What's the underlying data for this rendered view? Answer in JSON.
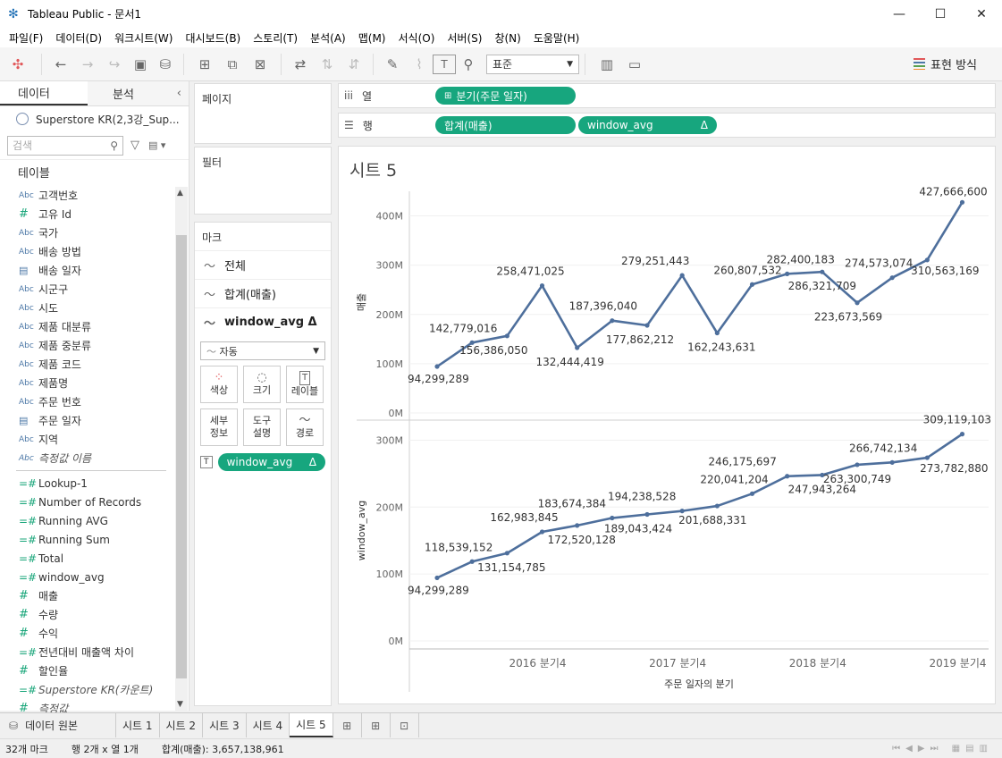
{
  "window": {
    "title": "Tableau Public - 문서1"
  },
  "menu": [
    "파일(F)",
    "데이터(D)",
    "워크시트(W)",
    "대시보드(B)",
    "스토리(T)",
    "분석(A)",
    "맵(M)",
    "서식(O)",
    "서버(S)",
    "창(N)",
    "도움말(H)"
  ],
  "toolbar": {
    "fit_value": "표준",
    "show_me": "표현 방식"
  },
  "left": {
    "tab_data": "데이터",
    "tab_analysis": "분석",
    "datasource": "Superstore KR(2,3강_Sup...",
    "search_placeholder": "검색",
    "tables_header": "테이블",
    "fields": [
      {
        "type": "Abc",
        "name": "고객번호"
      },
      {
        "type": "#",
        "name": "고유 Id"
      },
      {
        "type": "Abc",
        "name": "국가"
      },
      {
        "type": "Abc",
        "name": "배송 방법"
      },
      {
        "type": "cal",
        "name": "배송 일자"
      },
      {
        "type": "Abc",
        "name": "시군구"
      },
      {
        "type": "Abc",
        "name": "시도"
      },
      {
        "type": "Abc",
        "name": "제품 대분류"
      },
      {
        "type": "Abc",
        "name": "제품 중분류"
      },
      {
        "type": "Abc",
        "name": "제품 코드"
      },
      {
        "type": "Abc",
        "name": "제품명"
      },
      {
        "type": "Abc",
        "name": "주문 번호"
      },
      {
        "type": "cal",
        "name": "주문 일자"
      },
      {
        "type": "Abc",
        "name": "지역"
      },
      {
        "type": "Abc",
        "name": "측정값 이름",
        "italic": true
      }
    ],
    "measures": [
      {
        "type": "=#",
        "name": "Lookup-1"
      },
      {
        "type": "=#",
        "name": "Number of Records"
      },
      {
        "type": "=#",
        "name": "Running AVG"
      },
      {
        "type": "=#",
        "name": "Running Sum"
      },
      {
        "type": "=#",
        "name": "Total"
      },
      {
        "type": "=#",
        "name": "window_avg"
      },
      {
        "type": "#",
        "name": "매출"
      },
      {
        "type": "#",
        "name": "수량"
      },
      {
        "type": "#",
        "name": "수익"
      },
      {
        "type": "=#",
        "name": "전년대비 매출액 차이"
      },
      {
        "type": "#",
        "name": "할인율"
      },
      {
        "type": "=#",
        "name": "Superstore KR(카운트)",
        "italic": true
      },
      {
        "type": "#",
        "name": "측정값",
        "italic": true
      }
    ]
  },
  "cards": {
    "pages": "페이지",
    "filters": "필터",
    "marks": "마크",
    "mark_rows": [
      "전체",
      "합계(매출)",
      "window_avg Δ"
    ],
    "mark_type": "자동",
    "buttons": [
      {
        "icon": "color-icon",
        "label": "색상"
      },
      {
        "icon": "size-icon",
        "label": "크기"
      },
      {
        "icon": "label-icon",
        "label": "레이블"
      },
      {
        "icon": "detail-icon",
        "label": "세부\n정보"
      },
      {
        "icon": "tooltip-icon",
        "label": "도구\n설명"
      },
      {
        "icon": "path-icon",
        "label": "경로"
      }
    ],
    "label_pill": "window_avg",
    "label_pill_delta": "Δ"
  },
  "shelves": {
    "columns_label": "열",
    "rows_label": "행",
    "columns_pill": "분기(주문 일자)",
    "row_pills": [
      "합계(매출)",
      "window_avg"
    ],
    "delta": "Δ"
  },
  "sheet_title": "시트 5",
  "chart_data": [
    {
      "type": "line",
      "title": "",
      "ylabel": "매출",
      "xlabel": "주문 일자의 분기",
      "x_tick_labels": [
        "2016 분기4",
        "2017 분기4",
        "2018 분기4",
        "2019 분기4"
      ],
      "y_ticks": [
        "0M",
        "100M",
        "200M",
        "300M",
        "400M"
      ],
      "ylim": [
        0,
        450000000
      ],
      "values": [
        94299289,
        142779016,
        156386050,
        258471025,
        132444419,
        187396040,
        177862212,
        279251443,
        162243631,
        260807532,
        282400183,
        286321709,
        223673569,
        274573074,
        310563169,
        427666600
      ],
      "labels": [
        "94,299,289",
        "142,779,016",
        "156,386,050",
        "258,471,025",
        "132,444,419",
        "187,396,040",
        "177,862,212",
        "279,251,443",
        "162,243,631",
        "260,807,532",
        "282,400,183",
        "286,321,709",
        "223,673,569",
        "274,573,074",
        "310,563,169",
        "427,666,600"
      ],
      "color": "#4e6f9c"
    },
    {
      "type": "line",
      "title": "",
      "ylabel": "window_avg",
      "xlabel": "주문 일자의 분기",
      "y_ticks": [
        "0M",
        "100M",
        "200M",
        "300M"
      ],
      "ylim": [
        0,
        330000000
      ],
      "values": [
        94299289,
        118539152,
        131154785,
        162983845,
        172520128,
        183674384,
        189043424,
        194238528,
        201688331,
        220041204,
        246175697,
        247943264,
        263300749,
        266742134,
        273782880,
        309119103
      ],
      "labels": [
        "94,299,289",
        "118,539,152",
        "131,154,785",
        "162,983,845",
        "172,520,128",
        "183,674,384",
        "189,043,424",
        "194,238,528",
        "201,688,331",
        "220,041,204",
        "246,175,697",
        "247,943,264",
        "263,300,749",
        "266,742,134",
        "273,782,880",
        "309,119,103"
      ],
      "color": "#4e6f9c"
    }
  ],
  "tabs": {
    "datasource": "데이터 원본",
    "sheets": [
      "시트 1",
      "시트 2",
      "시트 3",
      "시트 4",
      "시트 5"
    ],
    "active": "시트 5"
  },
  "status": {
    "marks": "32개 마크",
    "rows_cols": "행 2개 x 열 1개",
    "sum": "합계(매출): 3,657,138,961"
  }
}
